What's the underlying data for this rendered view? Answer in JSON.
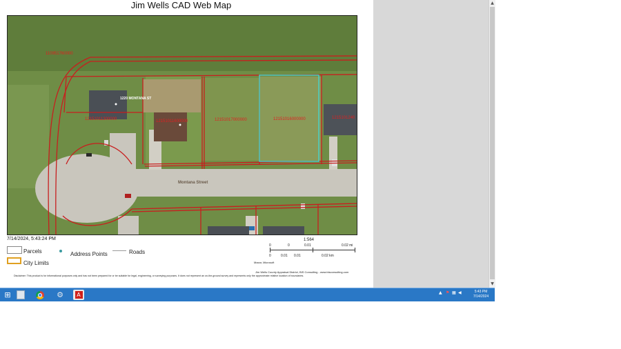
{
  "document": {
    "title": "Jim Wells CAD Web Map",
    "timestamp": "7/14/2024, 5:43:24 PM",
    "scale_ratio": "1:564",
    "scale_mi": [
      "0",
      "0",
      "0.01",
      "0.02 mi"
    ],
    "scale_km": [
      "0",
      "0.01",
      "0.01",
      "0.02 km"
    ],
    "attribution_short": "Maxar, Microsoft",
    "attribution_long": "Jim Wells County Appraisal District, BIS Consulting - www.bisconsulting.com",
    "disclaimer": "Disclaimer: This product is for informational purposes only and has not been prepared for or be suitable for legal, engineering, or surveying purposes. It does not represent an on-the-ground survey and represents only the approximate relative location of boundaries."
  },
  "legend": {
    "parcels": "Parcels",
    "address_points": "Address Points",
    "roads": "Roads",
    "city_limits": "City Limits"
  },
  "map": {
    "street_label": "Montana Street",
    "address_label": "1220 MONTANA ST",
    "parcel_ids": [
      "110951760000",
      "12151011300000",
      "12151011600000",
      "12151017000000",
      "12151016000000",
      "1215101240"
    ]
  },
  "taskbar": {
    "clock_time": "5:43 PM",
    "clock_date": "7/14/2024"
  },
  "colors": {
    "parcel_line": "#c81e1e",
    "selected_parcel": "#40d8d8",
    "taskbar": "#2a78c6",
    "road": "#c9c6bd",
    "grass": "#6b8a44"
  }
}
